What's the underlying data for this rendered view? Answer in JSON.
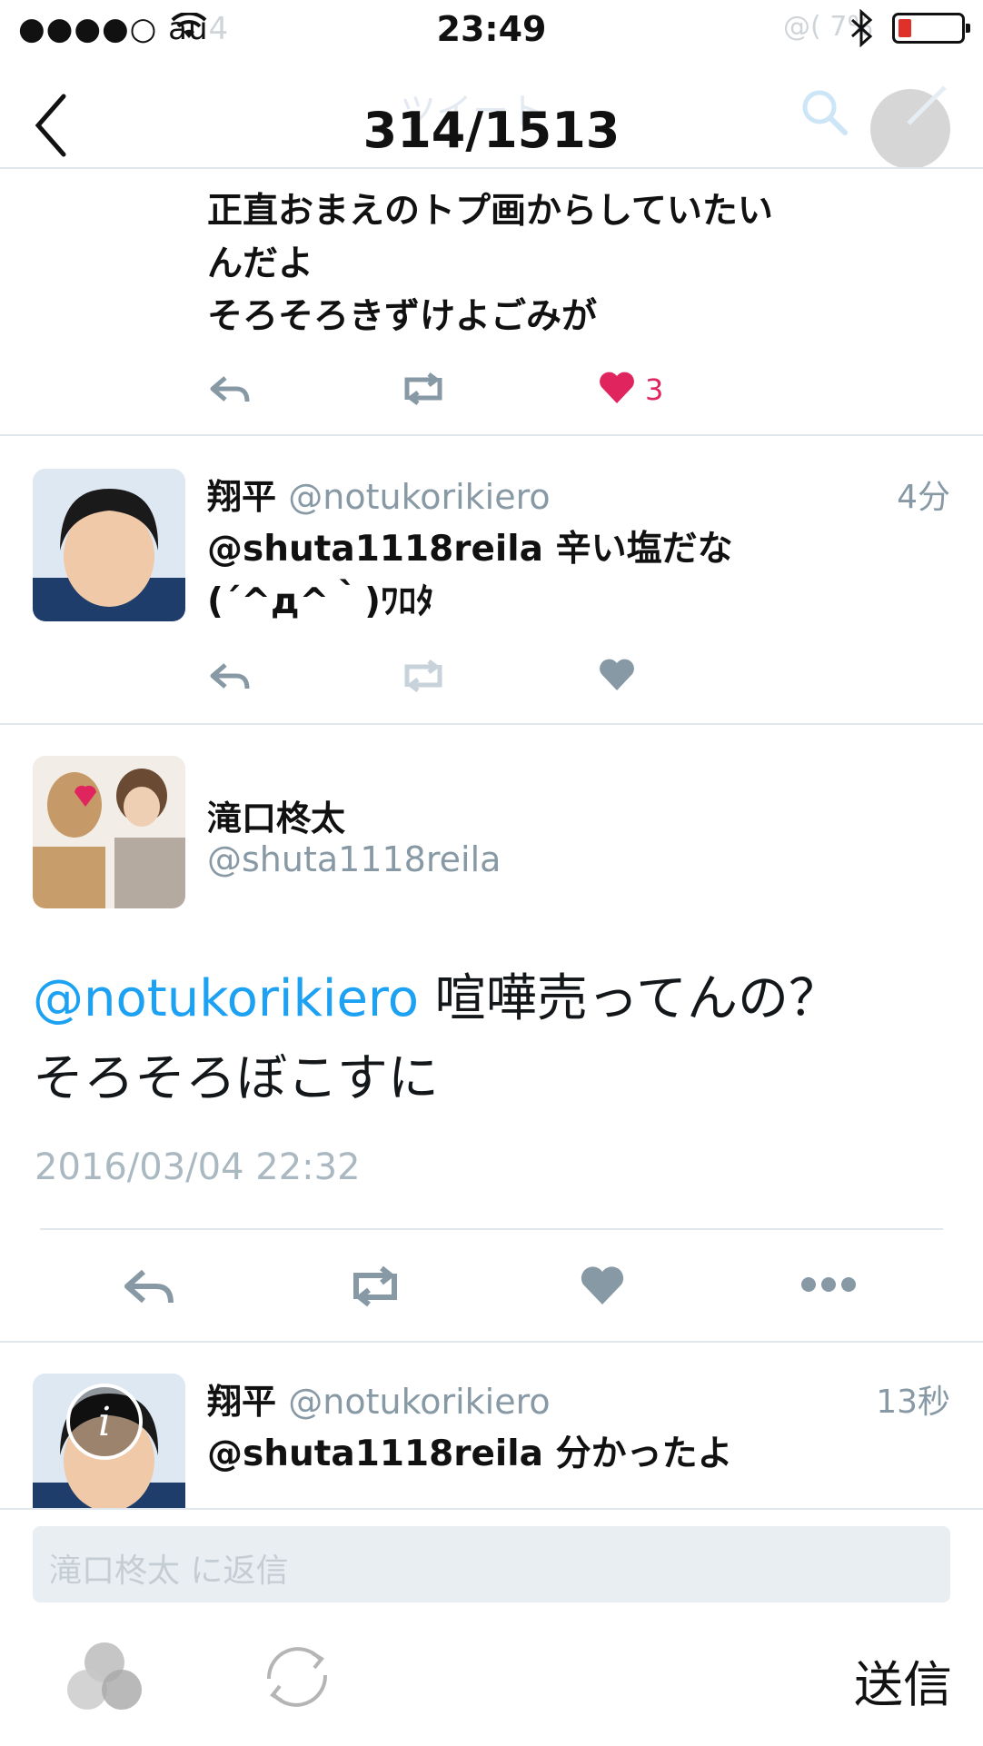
{
  "status_bar": {
    "carrier": "●●●●○ au",
    "carrier_ghost": "4",
    "time": "23:49",
    "ghost_right": "@( 7%"
  },
  "nav": {
    "title": "314/1513",
    "ghost_title": "ツイート"
  },
  "tweets_top": {
    "text_lines": "正直おまえのトプ画からしていたい\nんだよ\nそろそろきずけよごみが",
    "like_count": "3"
  },
  "tweet_reply_1": {
    "name": "翔平",
    "handle": "@notukorikiero",
    "time": "4分",
    "text_lines": "@shuta1118reila 辛い塩だな\n(´^д^｀)ﾜﾛﾀ"
  },
  "main_tweet": {
    "name": "滝口柊太",
    "handle": "@shuta1118reila",
    "mention": "@notukorikiero",
    "text_part1": " 喧嘩売ってんの？",
    "text_part2": "そろそろぼこすに",
    "datetime": "2016/03/04 22:32"
  },
  "tweet_reply_2": {
    "name": "翔平",
    "handle": "@notukorikiero",
    "time": "13秒",
    "text": "@shuta1118reila 分かったよ"
  },
  "composer": {
    "placeholder": "滝口柊太 に返信",
    "send_label": "送信"
  },
  "colors": {
    "accent": "#1da1f2",
    "muted": "#8899a6",
    "like_red": "#e0245e"
  }
}
